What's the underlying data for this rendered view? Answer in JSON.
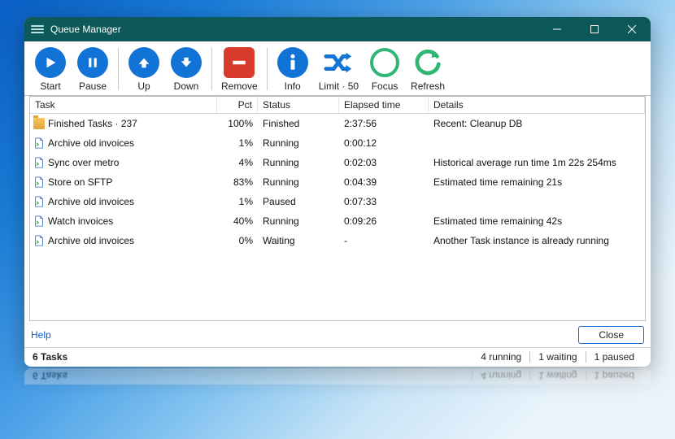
{
  "window": {
    "title": "Queue Manager"
  },
  "toolbar": {
    "start": "Start",
    "pause": "Pause",
    "up": "Up",
    "down": "Down",
    "remove": "Remove",
    "info": "Info",
    "limit": "Limit · 50",
    "focus": "Focus",
    "refresh": "Refresh"
  },
  "columns": {
    "task": "Task",
    "pct": "Pct",
    "status": "Status",
    "elapsed": "Elapsed time",
    "details": "Details"
  },
  "rows": [
    {
      "icon": "folder",
      "task": "Finished Tasks · 237",
      "pct": "100%",
      "status": "Finished",
      "elapsed": "2:37:56",
      "details": "Recent: Cleanup DB"
    },
    {
      "icon": "file",
      "task": "Archive old  invoices",
      "pct": "1%",
      "status": "Running",
      "elapsed": "0:00:12",
      "details": ""
    },
    {
      "icon": "file",
      "task": "Sync over metro",
      "pct": "4%",
      "status": "Running",
      "elapsed": "0:02:03",
      "details": "Historical average run time 1m 22s 254ms"
    },
    {
      "icon": "file",
      "task": "Store on SFTP",
      "pct": "83%",
      "status": "Running",
      "elapsed": "0:04:39",
      "details": "Estimated time remaining 21s"
    },
    {
      "icon": "file",
      "task": "Archive old  invoices",
      "pct": "1%",
      "status": "Paused",
      "elapsed": "0:07:33",
      "details": ""
    },
    {
      "icon": "file",
      "task": "Watch invoices",
      "pct": "40%",
      "status": "Running",
      "elapsed": "0:09:26",
      "details": "Estimated time remaining 42s"
    },
    {
      "icon": "file",
      "task": "Archive old  invoices",
      "pct": "0%",
      "status": "Waiting",
      "elapsed": "-",
      "details": "Another Task instance is already running"
    }
  ],
  "footer": {
    "help": "Help",
    "close": "Close"
  },
  "status": {
    "tasks": "6 Tasks",
    "running": "4 running",
    "waiting": "1 waiting",
    "paused": "1 paused"
  }
}
